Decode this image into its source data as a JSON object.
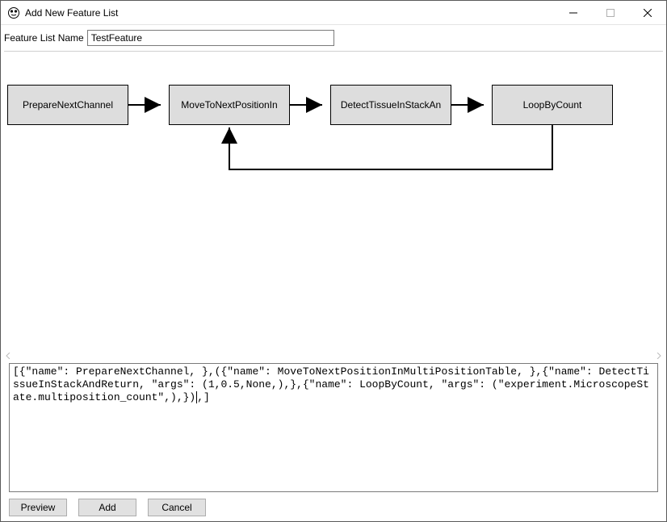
{
  "window": {
    "title": "Add New Feature List"
  },
  "form": {
    "name_label": "Feature List Name",
    "name_value": "TestFeature"
  },
  "nodes": {
    "n0": "PrepareNextChannel",
    "n1": "MoveToNextPositionIn",
    "n2": "DetectTissueInStackAn",
    "n3": "LoopByCount"
  },
  "code": {
    "text": "[{\"name\": PrepareNextChannel, },({\"name\": MoveToNextPositionInMultiPositionTable, },{\"name\": DetectTissueInStackAndReturn, \"args\": (1,0.5,None,),},{\"name\": LoopByCount, \"args\": (\"experiment.MicroscopeState.multiposition_count\",),})",
    "tail": ",]"
  },
  "buttons": {
    "preview": "Preview",
    "add": "Add",
    "cancel": "Cancel"
  }
}
